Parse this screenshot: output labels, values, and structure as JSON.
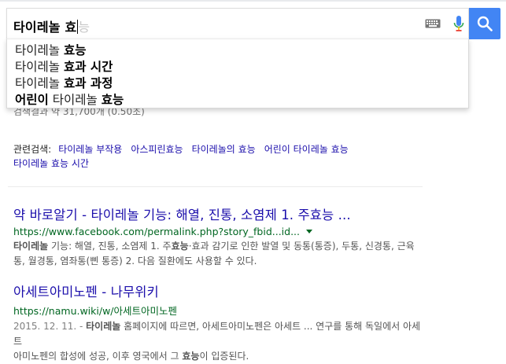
{
  "search": {
    "query_typed": "타이레놀 효",
    "query_ghost": "능",
    "keyboard_icon": "keyboard-icon",
    "mic_icon": "microphone-icon",
    "search_icon": "search-icon"
  },
  "suggestions": [
    {
      "plain": "타이레놀 ",
      "bold": "효능",
      "rest": ""
    },
    {
      "plain": "타이레놀 ",
      "bold": "효과 시간",
      "rest": ""
    },
    {
      "plain": "타이레놀 ",
      "bold": "효과 과정",
      "rest": ""
    },
    {
      "bold_prefix": "어린이",
      "plain": " 타이레놀 ",
      "bold": "효능"
    }
  ],
  "stats": "검색결과 약 31,700개 (0.50초)",
  "related": {
    "label": "관련검색:",
    "links": [
      "타이레놀 부작용",
      "아스피린효능",
      "타이레놀의 효능",
      "어린이 타이레놀 효능",
      "타이레놀 효능 시간"
    ]
  },
  "results": [
    {
      "title": "약 바로알기 - 타이레놀 기능: 해열, 진통, 소염제 1. 주효능 ...",
      "url": "https://www.facebook.com/permalink.php?story_fbid...id...",
      "snippet_line1_b": "타이레놀",
      "snippet_line1_a": " 기능: 해열, 진통, 소염제 1. 주",
      "snippet_line1_b2": "효능",
      "snippet_line1_c": "·효과 감기로 인한 발열 및 동통(통증), 두통, 신경통, 근육",
      "snippet_line2": "통, 월경통, 염좌통(삔 통증) 2. 다음 질환에도 사용할 수 있다."
    },
    {
      "title": "아세트아미노펜 - 나무위키",
      "url": "https://namu.wiki/w/아세트아미노펜",
      "date": "2015. 12. 11. - ",
      "snippet_b": "타이레놀",
      "snippet_line1": " 홈페이지에 따르면, 아세트아미노펜은 아세트 ... 연구를 통해 독일에서 아세트",
      "snippet_line2a": "아미노펜의 합성에 성공, 이후 영국에서 그 ",
      "snippet_line2b": "효능",
      "snippet_line2c": "이 입증된다."
    }
  ]
}
